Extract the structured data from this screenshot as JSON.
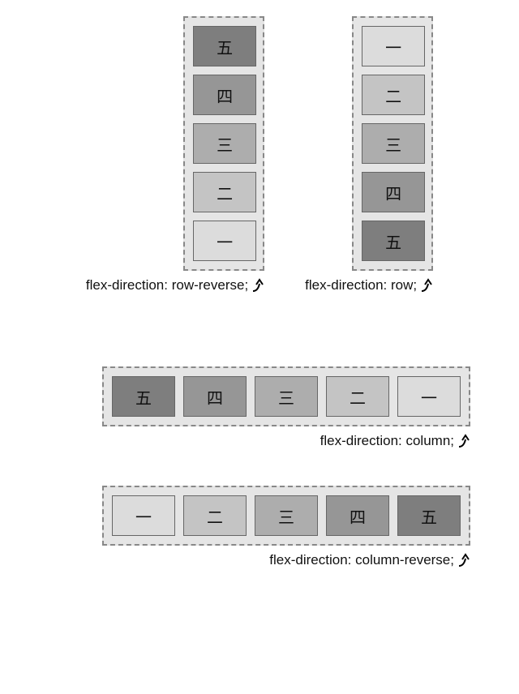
{
  "numerals": {
    "one": "一",
    "two": "二",
    "three": "三",
    "four": "四",
    "five": "五"
  },
  "captions": {
    "row_reverse": "flex-direction: row-reverse;",
    "row": "flex-direction: row;",
    "column": "flex-direction: column;",
    "column_reverse": "flex-direction: column-reverse;"
  },
  "shades": [
    "#dcdcdc",
    "#c4c4c4",
    "#adadad",
    "#969696",
    "#7e7e7e"
  ],
  "icons": {
    "arrow": "curved-arrow-up-right"
  },
  "layout": {
    "examples": [
      {
        "caption_key": "row_reverse",
        "orientation": "vertical",
        "order": [
          "five",
          "four",
          "three",
          "two",
          "one"
        ]
      },
      {
        "caption_key": "row",
        "orientation": "vertical",
        "order": [
          "one",
          "two",
          "three",
          "four",
          "five"
        ]
      },
      {
        "caption_key": "column",
        "orientation": "horizontal",
        "order": [
          "five",
          "four",
          "three",
          "two",
          "one"
        ]
      },
      {
        "caption_key": "column_reverse",
        "orientation": "horizontal",
        "order": [
          "one",
          "two",
          "three",
          "four",
          "five"
        ]
      }
    ]
  }
}
